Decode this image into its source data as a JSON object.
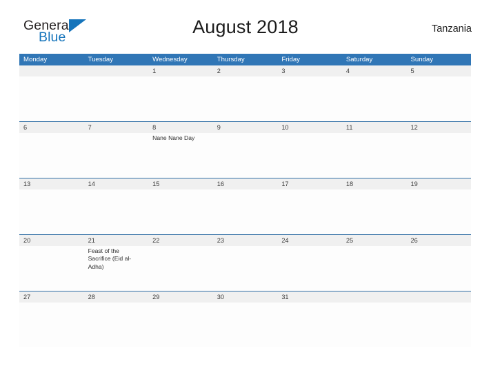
{
  "brand": {
    "name_part1": "General",
    "name_part2": "Blue",
    "triangle_color": "#1574bb"
  },
  "header": {
    "title": "August 2018",
    "country": "Tanzania"
  },
  "theme": {
    "header_blue": "#3076b6",
    "rule_blue": "#2e6da4",
    "daynum_band_gray": "#f0f0f0",
    "page_background": "#ffffff"
  },
  "calendar": {
    "weekday_headers": [
      "Monday",
      "Tuesday",
      "Wednesday",
      "Thursday",
      "Friday",
      "Saturday",
      "Sunday"
    ],
    "weeks": [
      {
        "days": [
          {
            "date": "",
            "event": ""
          },
          {
            "date": "",
            "event": ""
          },
          {
            "date": "1",
            "event": ""
          },
          {
            "date": "2",
            "event": ""
          },
          {
            "date": "3",
            "event": ""
          },
          {
            "date": "4",
            "event": ""
          },
          {
            "date": "5",
            "event": ""
          }
        ]
      },
      {
        "days": [
          {
            "date": "6",
            "event": ""
          },
          {
            "date": "7",
            "event": ""
          },
          {
            "date": "8",
            "event": "Nane Nane Day"
          },
          {
            "date": "9",
            "event": ""
          },
          {
            "date": "10",
            "event": ""
          },
          {
            "date": "11",
            "event": ""
          },
          {
            "date": "12",
            "event": ""
          }
        ]
      },
      {
        "days": [
          {
            "date": "13",
            "event": ""
          },
          {
            "date": "14",
            "event": ""
          },
          {
            "date": "15",
            "event": ""
          },
          {
            "date": "16",
            "event": ""
          },
          {
            "date": "17",
            "event": ""
          },
          {
            "date": "18",
            "event": ""
          },
          {
            "date": "19",
            "event": ""
          }
        ]
      },
      {
        "days": [
          {
            "date": "20",
            "event": ""
          },
          {
            "date": "21",
            "event": "Feast of the Sacrifice (Eid al-Adha)"
          },
          {
            "date": "22",
            "event": ""
          },
          {
            "date": "23",
            "event": ""
          },
          {
            "date": "24",
            "event": ""
          },
          {
            "date": "25",
            "event": ""
          },
          {
            "date": "26",
            "event": ""
          }
        ]
      },
      {
        "days": [
          {
            "date": "27",
            "event": ""
          },
          {
            "date": "28",
            "event": ""
          },
          {
            "date": "29",
            "event": ""
          },
          {
            "date": "30",
            "event": ""
          },
          {
            "date": "31",
            "event": ""
          },
          {
            "date": "",
            "event": ""
          },
          {
            "date": "",
            "event": ""
          }
        ]
      }
    ]
  }
}
